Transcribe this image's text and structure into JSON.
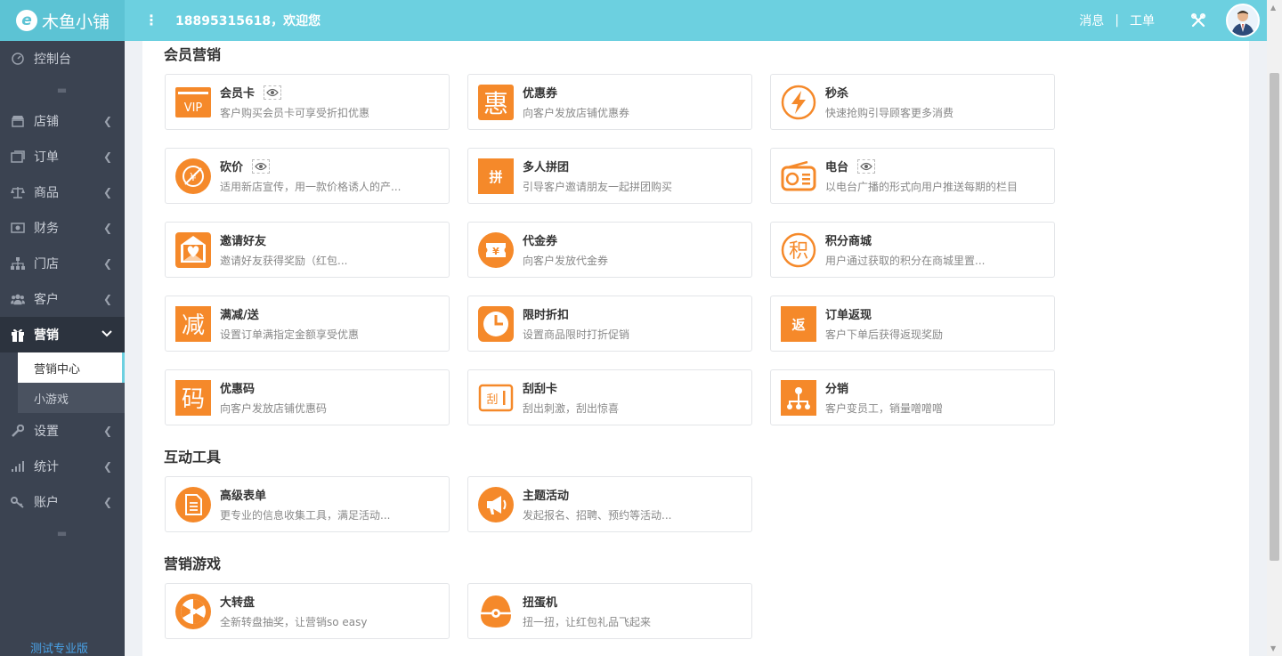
{
  "header": {
    "logo_text": "木鱼小铺",
    "logo_mark": "e",
    "welcome": "18895315618，欢迎您",
    "messages_label": "消息",
    "separator": "|",
    "ticket_label": "工单",
    "menu_icon": "⋮"
  },
  "sidebar": {
    "items": [
      {
        "label": "控制台",
        "icon": "dashboard-icon"
      },
      {
        "label": "店铺",
        "icon": "store-icon"
      },
      {
        "label": "订单",
        "icon": "order-icon"
      },
      {
        "label": "商品",
        "icon": "scale-icon"
      },
      {
        "label": "财务",
        "icon": "money-icon"
      },
      {
        "label": "门店",
        "icon": "branch-icon"
      },
      {
        "label": "客户",
        "icon": "users-icon"
      },
      {
        "label": "营销",
        "icon": "gift-icon"
      },
      {
        "label": "设置",
        "icon": "wrench-icon"
      },
      {
        "label": "统计",
        "icon": "signal-icon"
      },
      {
        "label": "账户",
        "icon": "key-icon"
      }
    ],
    "sub_items": [
      "营销中心",
      "小游戏"
    ],
    "version": "测试专业版"
  },
  "sections": {
    "member": "会员营销",
    "interactive": "互动工具",
    "games": "营销游戏"
  },
  "cards": {
    "vip": {
      "title": "会员卡",
      "desc": "客户购买会员卡可享受折扣优惠"
    },
    "coupon": {
      "title": "优惠券",
      "desc": "向客户发放店铺优惠券"
    },
    "seckill": {
      "title": "秒杀",
      "desc": "快速抢购引导顾客更多消费"
    },
    "bargain": {
      "title": "砍价",
      "desc": "适用新店宣传，用一款价格诱人的产..."
    },
    "group": {
      "title": "多人拼团",
      "desc": "引导客户邀请朋友一起拼团购买"
    },
    "radio": {
      "title": "电台",
      "desc": "以电台广播的形式向用户推送每期的栏目"
    },
    "invite": {
      "title": "邀请好友",
      "desc": "邀请好友获得奖励（红包..."
    },
    "voucher": {
      "title": "代金券",
      "desc": "向客户发放代金券"
    },
    "points": {
      "title": "积分商城",
      "desc": "用户通过获取的积分在商城里置..."
    },
    "discount": {
      "title": "满减/送",
      "desc": "设置订单满指定金额享受优惠"
    },
    "timed": {
      "title": "限时折扣",
      "desc": "设置商品限时打折促销"
    },
    "cashback": {
      "title": "订单返现",
      "desc": "客户下单后获得返现奖励"
    },
    "promocode": {
      "title": "优惠码",
      "desc": "向客户发放店铺优惠码"
    },
    "scratch": {
      "title": "刮刮卡",
      "desc": "刮出刺激，刮出惊喜"
    },
    "distribution": {
      "title": "分销",
      "desc": "客户变员工，销量噌噌噌"
    },
    "form": {
      "title": "高级表单",
      "desc": "更专业的信息收集工具，满足活动..."
    },
    "event": {
      "title": "主题活动",
      "desc": "发起报名、招聘、预约等活动..."
    },
    "wheel": {
      "title": "大转盘",
      "desc": "全新转盘抽奖，让营销so easy"
    },
    "capsule": {
      "title": "扭蛋机",
      "desc": "扭一扭，让红包礼品飞起来"
    }
  },
  "icon_glyphs": {
    "vip": "VIP",
    "coupon": "惠",
    "group": "拼",
    "points": "积",
    "discount": "减",
    "cashback": "返",
    "promocode": "码",
    "scratch": "刮"
  },
  "colors": {
    "header": "#6cd0e0",
    "sidebar": "#3b4351",
    "accent_orange": "#f5892a",
    "link_blue": "#4aa3e8"
  }
}
